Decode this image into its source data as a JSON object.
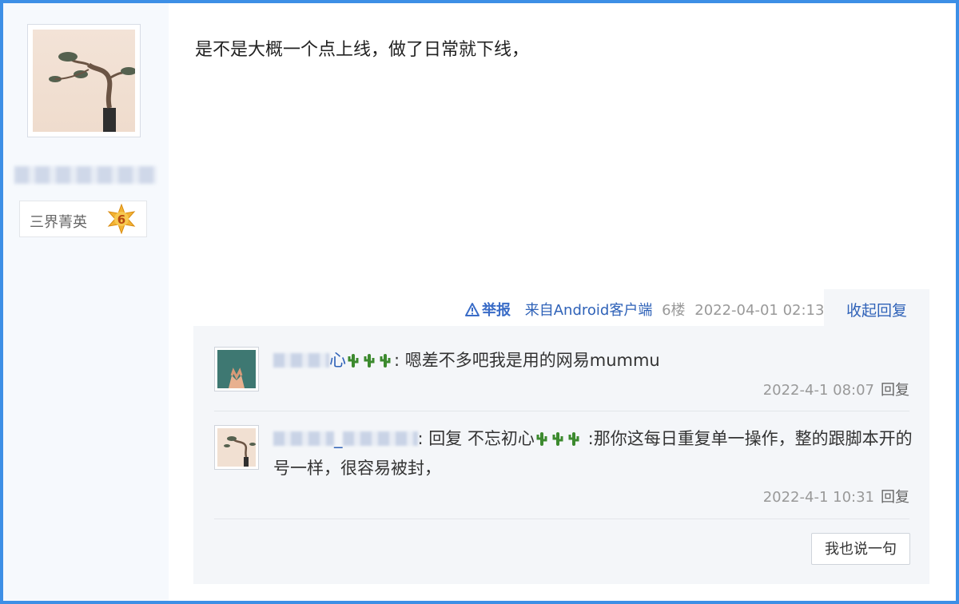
{
  "author": {
    "avatar_icon": "bonsai-avatar",
    "title": "三界菁英",
    "level": "6"
  },
  "post": {
    "content": "是不是大概一个点上线，做了日常就下线，",
    "report_label": "举报",
    "source": "来自Android客户端",
    "floor": "6楼",
    "time": "2022-04-01 02:13",
    "collapse_label": "收起回复"
  },
  "replies": [
    {
      "author_visible": "心",
      "text": ": 嗯差不多吧我是用的网易mummu",
      "time": "2022-4-1 08:07",
      "reply_label": "回复"
    },
    {
      "author_visible": "_",
      "prefix": ": 回复 不忘初心",
      "text": " :那你这每日重复单一操作，整的跟脚本开的号一样，很容易被封，",
      "time": "2022-4-1 10:31",
      "reply_label": "回复"
    }
  ],
  "say_button": "我也说一句",
  "colors": {
    "frame_border": "#3d8fe6",
    "link_blue": "#2f62b8",
    "panel_bg": "#f4f6f9"
  }
}
